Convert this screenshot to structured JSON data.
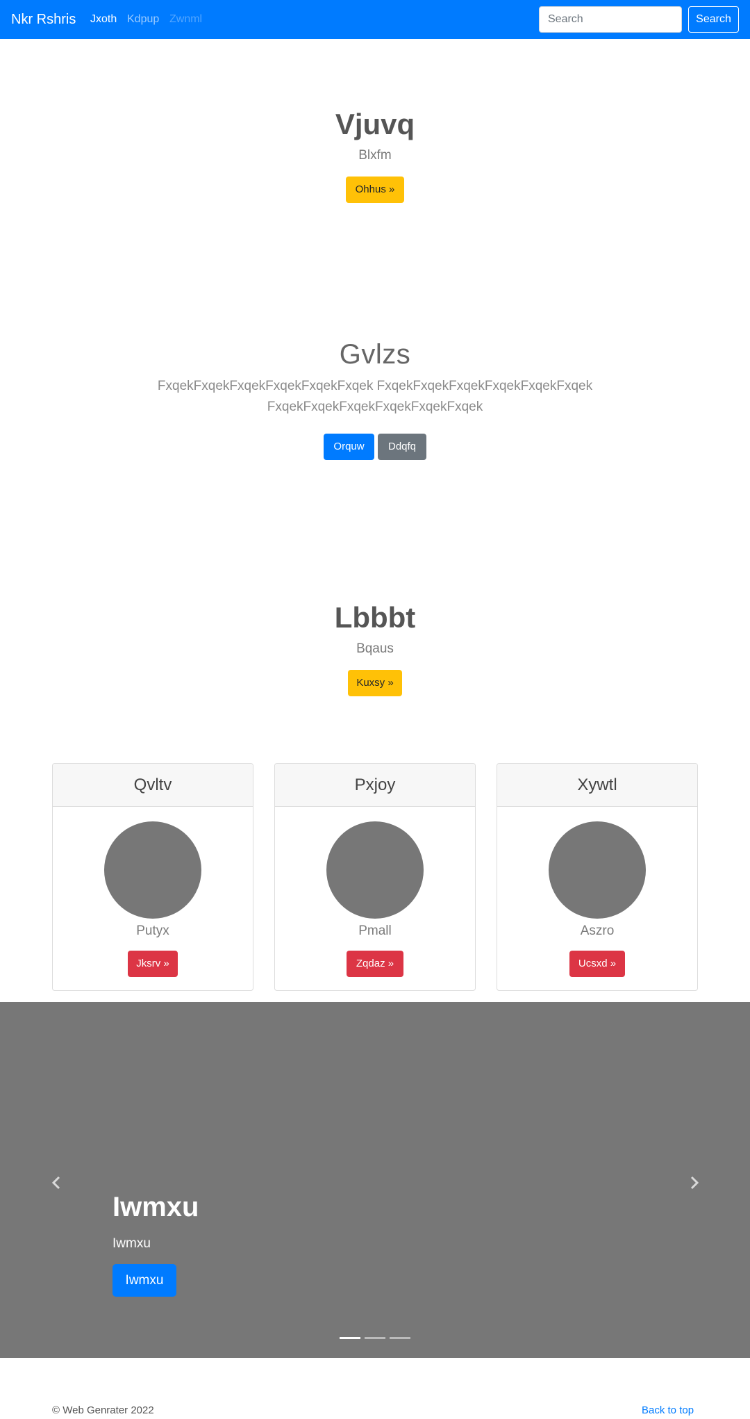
{
  "navbar": {
    "brand": "Nkr Rshris",
    "links": [
      "Jxoth",
      "Kdpup",
      "Zwnml"
    ],
    "search_placeholder": "Search",
    "search_button": "Search"
  },
  "hero1": {
    "title": "Vjuvq",
    "subtitle": "Blxfm",
    "button": "Ohhus »"
  },
  "hero2": {
    "title": "Gvlzs",
    "text_line1": "FxqekFxqekFxqekFxqekFxqekFxqek FxqekFxqekFxqekFxqekFxqekFxqek",
    "text_line2": "FxqekFxqekFxqekFxqekFxqekFxqek",
    "button_primary": "Orquw",
    "button_secondary": "Ddqfq"
  },
  "hero3": {
    "title": "Lbbbt",
    "subtitle": "Bqaus",
    "button": "Kuxsy »"
  },
  "cards": [
    {
      "header": "Qvltv",
      "text": "Putyx",
      "button": "Jksrv »"
    },
    {
      "header": "Pxjoy",
      "text": "Pmall",
      "button": "Zqdaz »"
    },
    {
      "header": "Xywtl",
      "text": "Aszro",
      "button": "Ucsxd »"
    }
  ],
  "carousel": {
    "title": "Iwmxu",
    "subtitle": "Iwmxu",
    "button": "Iwmxu",
    "prev_icon": "chevron-left-icon",
    "next_icon": "chevron-right-icon",
    "active_slide": 1,
    "slide_count": 3
  },
  "footer": {
    "copyright": "© Web Genrater 2022",
    "back_to_top": "Back to top"
  },
  "colors": {
    "primary": "#007bff",
    "warning": "#ffc107",
    "danger": "#dc3545",
    "secondary": "#6c757d",
    "carousel_bg": "#777777"
  }
}
